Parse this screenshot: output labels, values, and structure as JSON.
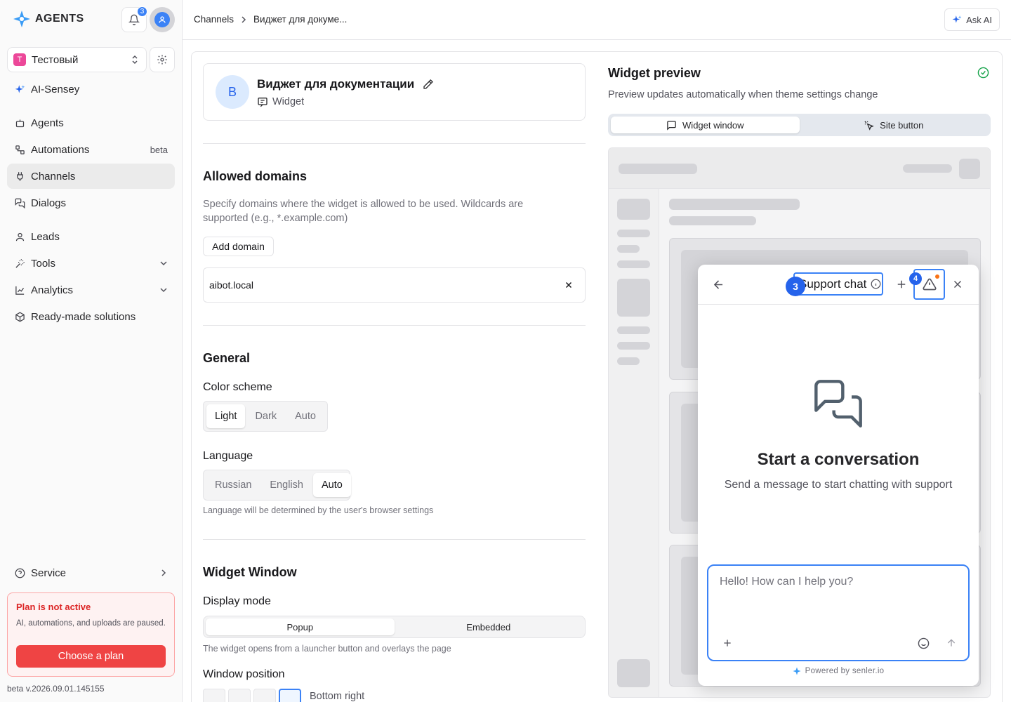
{
  "brand": {
    "name": "AGENTS",
    "notifications": "3"
  },
  "workspace": {
    "badge": "T",
    "name": "Тестовый"
  },
  "sidebar": {
    "ai_item": "AI-Sensey",
    "items": [
      {
        "label": "Agents"
      },
      {
        "label": "Automations",
        "badge": "beta"
      },
      {
        "label": "Channels"
      },
      {
        "label": "Dialogs"
      },
      {
        "label": "Leads"
      },
      {
        "label": "Tools"
      },
      {
        "label": "Analytics"
      },
      {
        "label": "Ready-made solutions"
      }
    ],
    "service": "Service",
    "plan": {
      "title": "Plan is not active",
      "desc": "AI, automations, and uploads are paused.",
      "button": "Choose a plan"
    },
    "version": "beta v.2026.09.01.145155"
  },
  "header": {
    "breadcrumbs": [
      "Channels",
      "Виджет для докуме..."
    ],
    "ask_ai": "Ask AI"
  },
  "widget": {
    "avatar": "B",
    "name": "Виджет для документации",
    "type": "Widget"
  },
  "domains": {
    "title": "Allowed domains",
    "desc": "Specify domains where the widget is allowed to be used. Wildcards are supported (e.g., *.example.com)",
    "add_button": "Add domain",
    "items": [
      "aibot.local"
    ]
  },
  "general": {
    "title": "General",
    "color_scheme": {
      "label": "Color scheme",
      "options": [
        "Light",
        "Dark",
        "Auto"
      ],
      "selected": "Light"
    },
    "language": {
      "label": "Language",
      "options": [
        "Russian",
        "English",
        "Auto"
      ],
      "selected": "Auto",
      "hint": "Language will be determined by the user's browser settings"
    }
  },
  "window": {
    "title": "Widget Window",
    "display_mode": {
      "label": "Display mode",
      "options": [
        "Popup",
        "Embedded"
      ],
      "selected": "Popup",
      "hint": "The widget opens from a launcher button and overlays the page"
    },
    "position": {
      "label": "Window position",
      "selected": "Bottom right"
    }
  },
  "preview": {
    "title": "Widget preview",
    "subtitle": "Preview updates automatically when theme settings change",
    "tabs": [
      "Widget window",
      "Site button"
    ],
    "selected_tab": "Widget window",
    "chat": {
      "title": "Support chat",
      "empty_title": "Start a conversation",
      "empty_sub": "Send a message to start chatting with support",
      "placeholder": "Hello! How can I help you?",
      "powered": "Powered by senler.io",
      "markers": [
        "3",
        "4"
      ]
    }
  },
  "colors": {
    "accent": "#3b82f6",
    "danger": "#ef4444",
    "plan_bg": "#fef2f2"
  }
}
